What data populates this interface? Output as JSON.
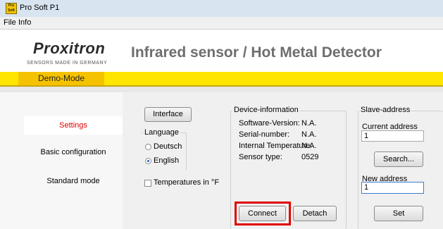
{
  "window": {
    "title": "Pro Soft P1",
    "icon_text": "Pro Soft"
  },
  "menu": {
    "items": [
      "File",
      "Info"
    ]
  },
  "header": {
    "logo": "Proxitron",
    "logo_tagline": "SENSORS MADE IN GERMANY",
    "heading": "Infrared sensor  / Hot Metal Detector"
  },
  "mode": {
    "label": "Demo-Mode"
  },
  "nav": {
    "items": [
      "Settings",
      "Basic configuration",
      "Standard mode"
    ]
  },
  "settings": {
    "interface_button": "Interface",
    "language_title": "Language",
    "language_options": [
      "Deutsch",
      "English"
    ],
    "language_selected": "English",
    "temperature_checkbox": "Temperatures in °F",
    "temperature_checked": false
  },
  "device_info": {
    "title": "Device-information",
    "rows": [
      {
        "label": "Software-Version:",
        "value": "N.A."
      },
      {
        "label": "Serial-number:",
        "value": "N.A."
      },
      {
        "label": "Internal Temperature:",
        "value": "N.A."
      },
      {
        "label": "Sensor type:",
        "value": "0529"
      }
    ],
    "connect_button": "Connect",
    "detach_button": "Detach"
  },
  "slave_address": {
    "title": "Slave-address",
    "current_label": "Current address",
    "current_value": "1",
    "search_button": "Search...",
    "new_label": "New address",
    "new_value": "1",
    "set_button": "Set"
  },
  "colors": {
    "demo_bar": "#ffe500",
    "demo_label": "#f5c200",
    "active_nav": "#e00000",
    "highlight": "#e00000"
  }
}
